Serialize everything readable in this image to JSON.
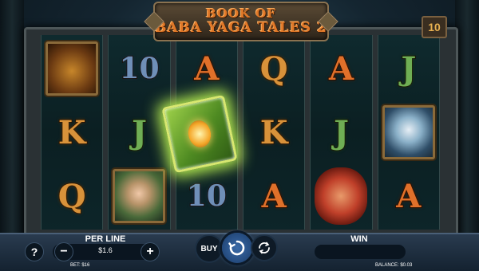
{
  "game": {
    "title_line1": "BOOK OF",
    "title_line2": "BABA YAGA TALES 2",
    "lines_count": "10"
  },
  "reels": [
    [
      "dragon",
      "K",
      "Q"
    ],
    [
      "10",
      "J",
      "fairy"
    ],
    [
      "A",
      "book",
      "10"
    ],
    [
      "Q",
      "K",
      "A"
    ],
    [
      "A",
      "J",
      "goblin"
    ],
    [
      "J",
      "elder",
      "A"
    ]
  ],
  "controls": {
    "help_label": "?",
    "per_line_label": "PER LINE",
    "per_line_value": "$1.6",
    "minus_label": "−",
    "plus_label": "+",
    "buy_label": "BUY",
    "win_label": "WIN",
    "bet_text": "BET: $16",
    "balance_text": "BALANCE: $0.03"
  },
  "colors": {
    "card_gold": "#d8923a",
    "card_orange": "#e0702a",
    "card_green": "#6fae54",
    "card_blue": "#6f8fb8",
    "book_glow": "#b8f050",
    "spin_blue": "#3a6aa8"
  }
}
